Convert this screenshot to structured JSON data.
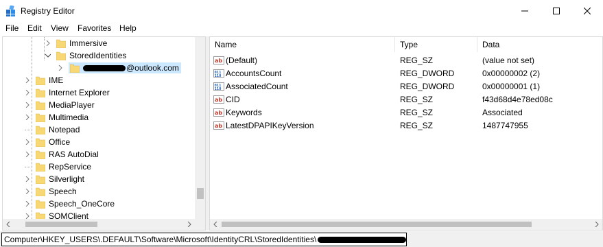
{
  "window": {
    "title": "Registry Editor"
  },
  "menu": [
    "File",
    "Edit",
    "View",
    "Favorites",
    "Help"
  ],
  "tree": {
    "items": [
      {
        "label": "Immersive",
        "expandable": true,
        "expanded": false
      },
      {
        "label": "StoredIdentities",
        "expandable": true,
        "expanded": true
      },
      {
        "label": "@outlook.com",
        "expandable": true,
        "expanded": false,
        "selected": true,
        "redacted_prefix": true
      },
      {
        "label": "IME",
        "expandable": true
      },
      {
        "label": "Internet Explorer",
        "expandable": true
      },
      {
        "label": "MediaPlayer",
        "expandable": true
      },
      {
        "label": "Multimedia",
        "expandable": true
      },
      {
        "label": "Notepad",
        "expandable": false
      },
      {
        "label": "Office",
        "expandable": true
      },
      {
        "label": "RAS AutoDial",
        "expandable": true
      },
      {
        "label": "RepService",
        "expandable": false
      },
      {
        "label": "Silverlight",
        "expandable": true
      },
      {
        "label": "Speech",
        "expandable": true
      },
      {
        "label": "Speech_OneCore",
        "expandable": true
      },
      {
        "label": "SQMClient",
        "expandable": true
      }
    ]
  },
  "list": {
    "columns": [
      "Name",
      "Type",
      "Data"
    ],
    "rows": [
      {
        "icon": "string-value-icon",
        "name": "(Default)",
        "type": "REG_SZ",
        "data": "(value not set)"
      },
      {
        "icon": "binary-value-icon",
        "name": "AccountsCount",
        "type": "REG_DWORD",
        "data": "0x00000002 (2)"
      },
      {
        "icon": "binary-value-icon",
        "name": "AssociatedCount",
        "type": "REG_DWORD",
        "data": "0x00000001 (1)"
      },
      {
        "icon": "string-value-icon",
        "name": "CID",
        "type": "REG_SZ",
        "data": "f43d68d4e78ed08c"
      },
      {
        "icon": "string-value-icon",
        "name": "Keywords",
        "type": "REG_SZ",
        "data": "Associated"
      },
      {
        "icon": "string-value-icon",
        "name": "LatestDPAPIKeyVersion",
        "type": "REG_SZ",
        "data": "1487747955"
      }
    ]
  },
  "status": {
    "path": "Computer\\HKEY_USERS\\.DEFAULT\\Software\\Microsoft\\IdentityCRL\\StoredIdentities\\"
  },
  "colors": {
    "selection": "#cce8ff",
    "folder": "#f8d775",
    "accent": "#0078d7"
  }
}
